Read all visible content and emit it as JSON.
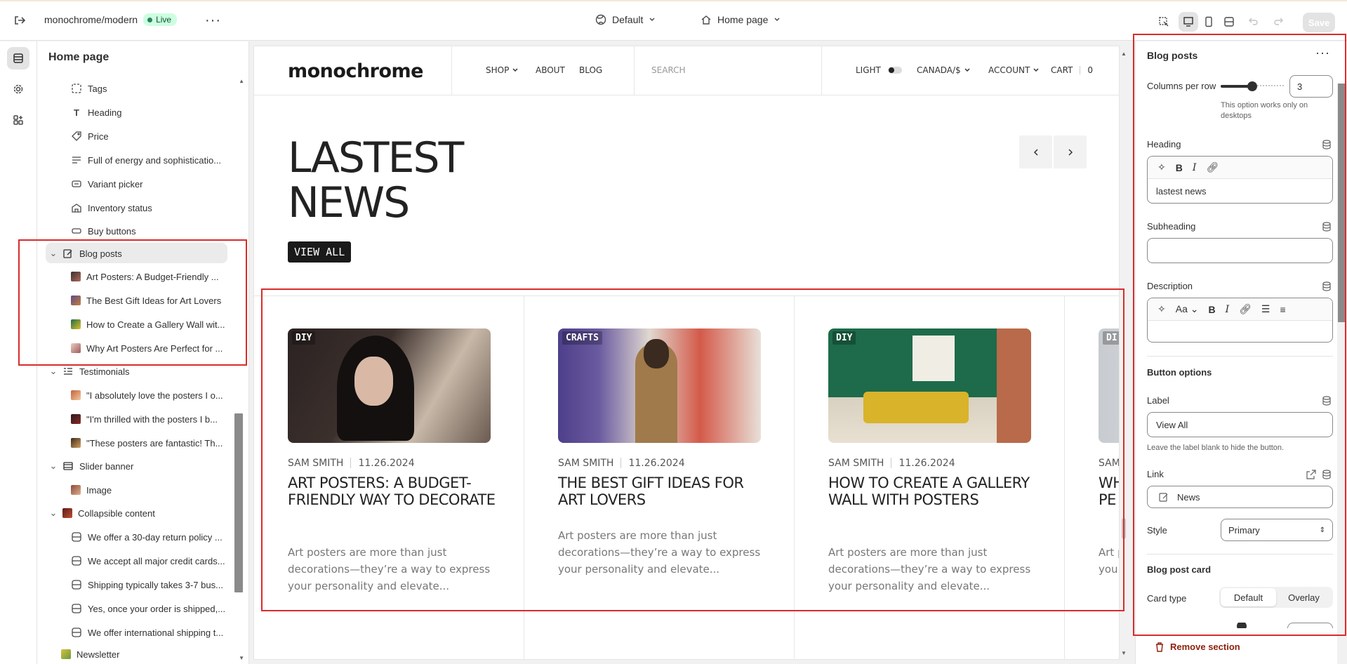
{
  "topbar": {
    "store_name": "monochrome/modern",
    "live_badge": "Live",
    "theme_select": "Default",
    "page_select": "Home page",
    "save_label": "Save"
  },
  "tree": {
    "title": "Home page",
    "items": [
      {
        "label": "Tags",
        "icon": "tags-icon"
      },
      {
        "label": "Heading",
        "icon": "heading-icon"
      },
      {
        "label": "Price",
        "icon": "price-tag-icon"
      },
      {
        "label": "Full of energy and sophisticatio...",
        "icon": "text-align-icon"
      },
      {
        "label": "Variant picker",
        "icon": "variant-picker-icon"
      },
      {
        "label": "Inventory status",
        "icon": "inventory-icon"
      },
      {
        "label": "Buy buttons",
        "icon": "buy-buttons-icon"
      }
    ],
    "blog_section": {
      "label": "Blog posts",
      "children": [
        "Art Posters: A Budget-Friendly ...",
        "The Best Gift Ideas for Art Lovers",
        "How to Create a Gallery Wall wit...",
        "Why Art Posters Are Perfect for ..."
      ]
    },
    "testimonials": {
      "label": "Testimonials",
      "children": [
        "\"I absolutely love the posters I o...",
        "\"I'm thrilled with the posters I b...",
        "\"These posters are fantastic! Th..."
      ]
    },
    "slider": {
      "label": "Slider banner",
      "children": [
        "Image"
      ]
    },
    "collapsible": {
      "label": "Collapsible content",
      "children": [
        "We offer a 30-day return policy ...",
        "We accept all major credit cards...",
        "Shipping typically takes 3-7 bus...",
        "Yes, once your order is shipped,...",
        "We offer international shipping t..."
      ]
    },
    "newsletter": "Newsletter"
  },
  "site": {
    "logo": "monochrome",
    "nav": [
      "SHOP",
      "ABOUT",
      "BLOG"
    ],
    "search_placeholder": "SEARCH",
    "light_label": "LIGHT",
    "currency": "CANADA/$",
    "account": "ACCOUNT",
    "cart": "CART",
    "cart_count": "0",
    "headline_line1": "LASTEST",
    "headline_line2": "NEWS",
    "view_all": "VIEW ALL",
    "cards": [
      {
        "tag": "DIY",
        "author": "SAM SMITH",
        "date": "11.26.2024",
        "title": "ART POSTERS: A BUDGET-FRIENDLY WAY TO DECORATE",
        "excerpt": "Art posters are more than just decorations—they’re a way to express your personality and elevate..."
      },
      {
        "tag": "CRAFTS",
        "author": "SAM SMITH",
        "date": "11.26.2024",
        "title": "THE BEST GIFT IDEAS FOR ART LOVERS",
        "excerpt": "Art posters are more than just decorations—they’re a way to express your personality and elevate..."
      },
      {
        "tag": "DIY",
        "author": "SAM SMITH",
        "date": "11.26.2024",
        "title": "HOW TO CREATE A GALLERY WALL WITH POSTERS",
        "excerpt": "Art posters are more than just decorations—they’re a way to express your personality and elevate..."
      },
      {
        "tag": "DI",
        "author": "SAM",
        "date": "",
        "title": "WH PE",
        "excerpt": "Art p you"
      }
    ]
  },
  "props": {
    "section_title": "Blog posts",
    "columns_label": "Columns per row",
    "columns_value": "3",
    "columns_slider_level": 0.5,
    "columns_hint": "This option works only on desktops",
    "heading_label": "Heading",
    "heading_value": "lastest news",
    "subheading_label": "Subheading",
    "subheading_value": "",
    "description_label": "Description",
    "button_options_title": "Button options",
    "label_label": "Label",
    "label_value": "View All",
    "label_hint": "Leave the label blank to hide the button.",
    "link_label": "Link",
    "link_value": "News",
    "style_label": "Style",
    "style_value": "Primary",
    "card_section_title": "Blog post card",
    "card_type_label": "Card type",
    "card_type_options": [
      "Default",
      "Overlay"
    ],
    "remove_label": "Remove section"
  },
  "colors": {
    "annotation_red": "#d82c2c",
    "live_green": "#29845a",
    "remove_red": "#8e1f0b"
  }
}
